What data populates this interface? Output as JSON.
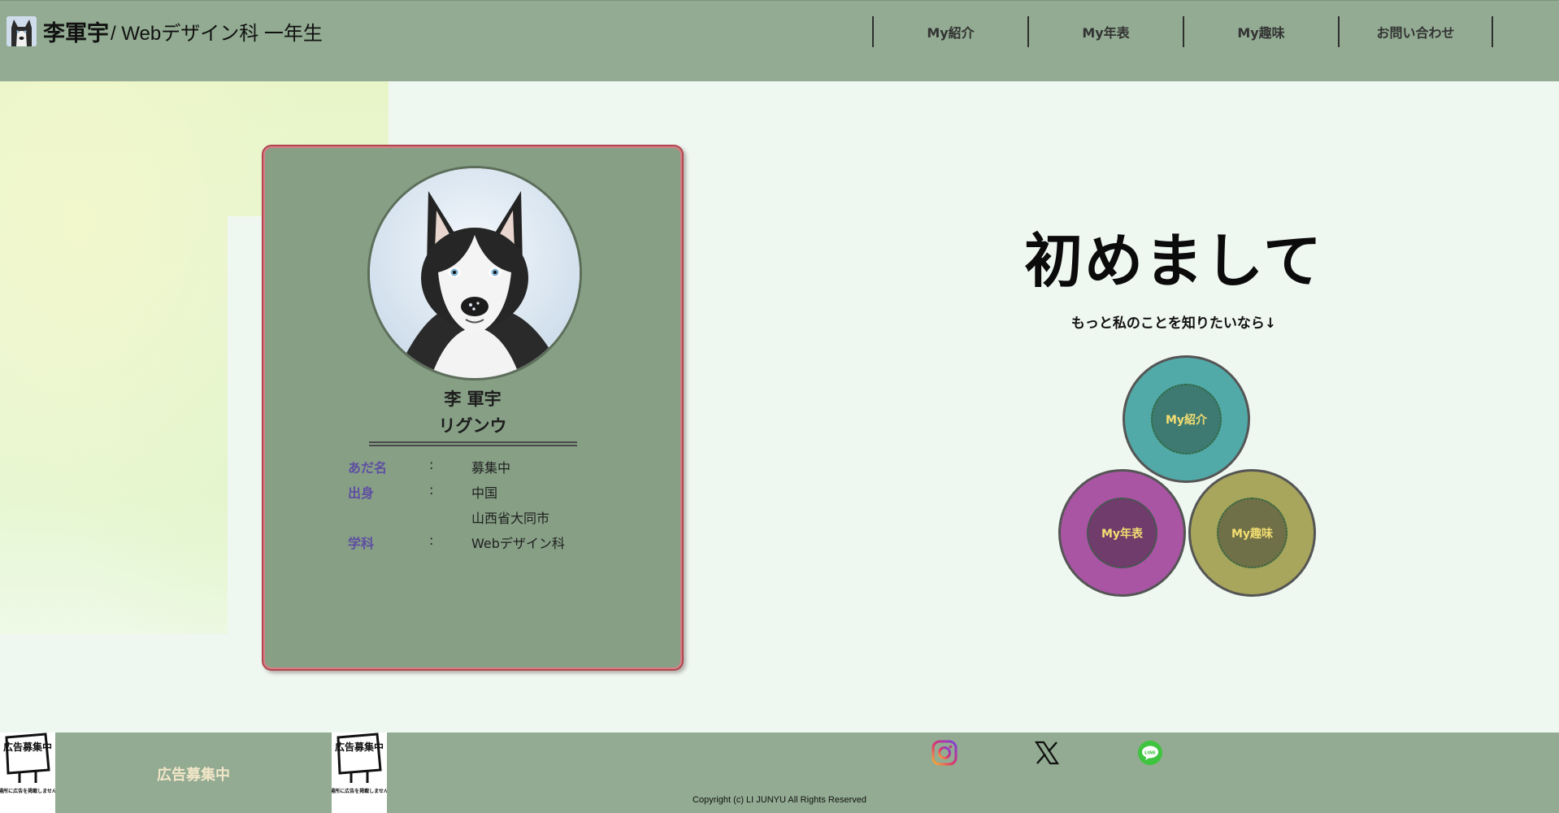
{
  "header": {
    "name": "李軍宇",
    "subtitle": "/ Webデザイン科 一年生",
    "nav": [
      "My紹介",
      "My年表",
      "My趣味",
      "お問い合わせ"
    ]
  },
  "card": {
    "name": "李 軍宇",
    "kana": "リグンウ",
    "rows": [
      {
        "key": "あだ名",
        "sep": ":",
        "value": "募集中"
      },
      {
        "key": "出身",
        "sep": ":",
        "value": "中国"
      },
      {
        "key": "",
        "sep": "",
        "value": "山西省大同市"
      },
      {
        "key": "学科",
        "sep": ":",
        "value": "Webデザイン科"
      }
    ]
  },
  "hero": {
    "title": "初めまして",
    "subtitle": "もっと私のことを知りたいなら↓",
    "bubbles": [
      "My紹介",
      "My年表",
      "My趣味"
    ]
  },
  "footer": {
    "ad_label": "広告募集中",
    "ad_sign_title": "広告募集中",
    "ad_sign_text": "この場所に広告を掲載しませんか？",
    "copyright": "Copyright (c) LI JUNYU All Rights Reserved",
    "social": [
      "instagram-icon",
      "x-icon",
      "line-icon"
    ]
  },
  "colors": {
    "header_bg": "#92ab92",
    "page_bg": "#eff7f1",
    "card_bg": "#869f85",
    "card_border": "#b2464f",
    "label_purple": "#5f4fa2",
    "bubble_teal": "#52aaa8",
    "bubble_purple": "#a955a4",
    "bubble_olive": "#a7a65c",
    "bubble_text": "#f3de71"
  }
}
